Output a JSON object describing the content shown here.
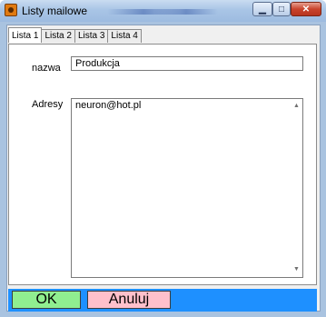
{
  "window": {
    "title": "Listy mailowe",
    "controls": {
      "minimize_icon": "minimize-icon",
      "maximize_icon": "maximize-icon",
      "close_icon": "close-icon"
    }
  },
  "tabs": [
    {
      "label": "Lista 1",
      "active": true
    },
    {
      "label": "Lista 2",
      "active": false
    },
    {
      "label": "Lista 3",
      "active": false
    },
    {
      "label": "Lista 4",
      "active": false
    }
  ],
  "form": {
    "name_label": "nazwa",
    "name_value": "Produkcja",
    "addresses_label": "Adresy",
    "addresses_value": "neuron@hot.pl"
  },
  "buttons": {
    "ok_label": "OK",
    "cancel_label": "Anuluj"
  },
  "colors": {
    "ok_bg": "#90ee90",
    "cancel_bg": "#ffc0cb",
    "bottom_bar": "#1e90ff",
    "titlebar": "#a9c5e6"
  }
}
